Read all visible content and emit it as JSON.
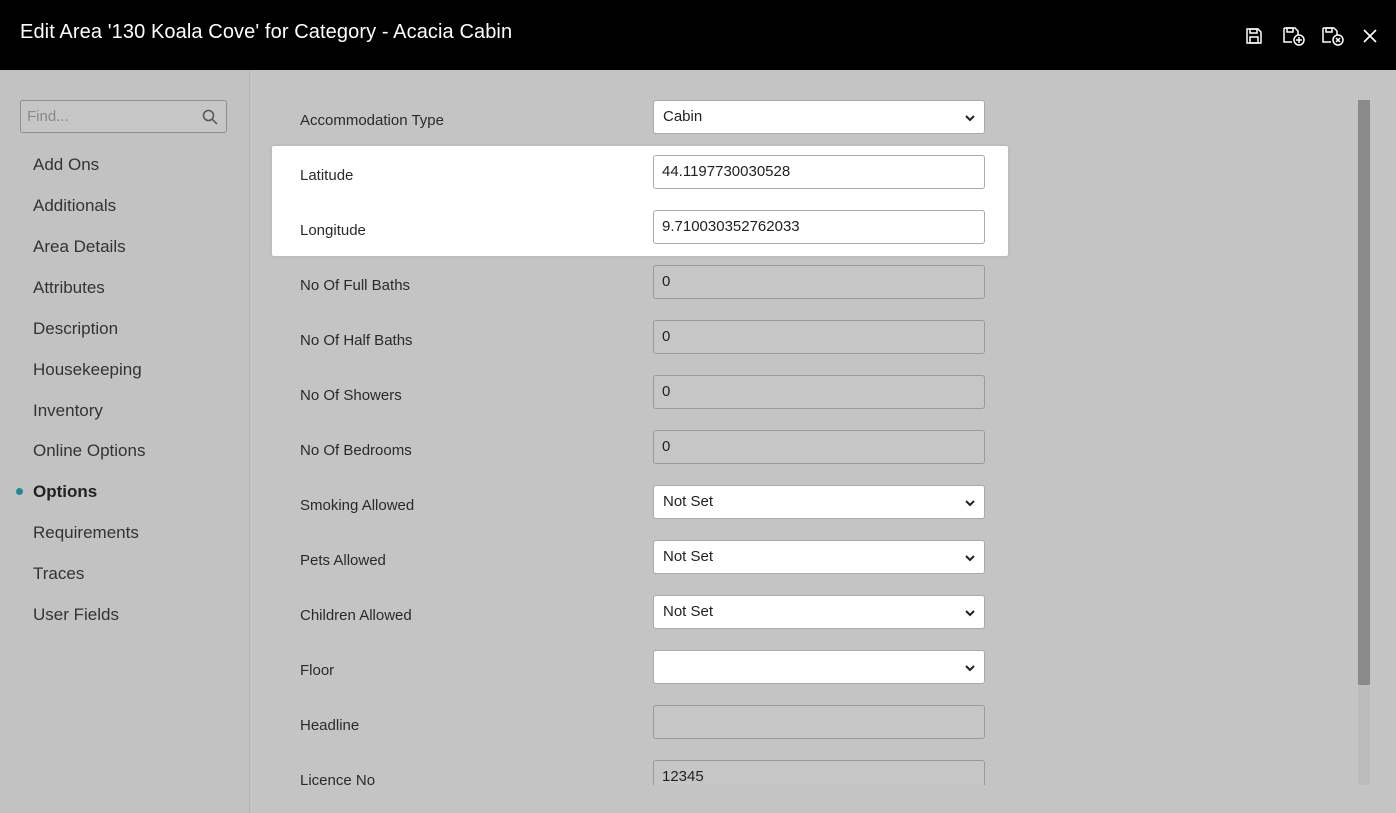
{
  "window": {
    "title": "Edit Area '130 Koala Cove' for Category - Acacia Cabin",
    "icons": [
      "save-icon",
      "save-and-new-icon",
      "save-and-close-icon",
      "close-icon"
    ]
  },
  "sidebar": {
    "search_placeholder": "Find...",
    "items": [
      {
        "label": "Add Ons"
      },
      {
        "label": "Additionals"
      },
      {
        "label": "Area Details"
      },
      {
        "label": "Attributes"
      },
      {
        "label": "Description"
      },
      {
        "label": "Housekeeping"
      },
      {
        "label": "Inventory"
      },
      {
        "label": "Online Options"
      },
      {
        "label": "Options",
        "active": true
      },
      {
        "label": "Requirements"
      },
      {
        "label": "Traces"
      },
      {
        "label": "User Fields"
      }
    ],
    "active_color": "#1d8a9a"
  },
  "form": {
    "fields": [
      {
        "label": "Accommodation Type",
        "type": "select",
        "value": "Cabin"
      },
      {
        "label": "Latitude",
        "type": "input",
        "value": "44.1197730030528"
      },
      {
        "label": "Longitude",
        "type": "input",
        "value": "9.710030352762033"
      },
      {
        "label": "No Of Full Baths",
        "type": "input",
        "value": "0"
      },
      {
        "label": "No Of Half Baths",
        "type": "input",
        "value": "0"
      },
      {
        "label": "No Of Showers",
        "type": "input",
        "value": "0"
      },
      {
        "label": "No Of Bedrooms",
        "type": "input",
        "value": "0"
      },
      {
        "label": "Smoking Allowed",
        "type": "select",
        "value": "Not Set"
      },
      {
        "label": "Pets Allowed",
        "type": "select",
        "value": "Not Set"
      },
      {
        "label": "Children Allowed",
        "type": "select",
        "value": "Not Set"
      },
      {
        "label": "Floor",
        "type": "select",
        "value": ""
      },
      {
        "label": "Headline",
        "type": "input",
        "value": ""
      },
      {
        "label": "Licence No",
        "type": "input",
        "value": "12345"
      }
    ]
  }
}
